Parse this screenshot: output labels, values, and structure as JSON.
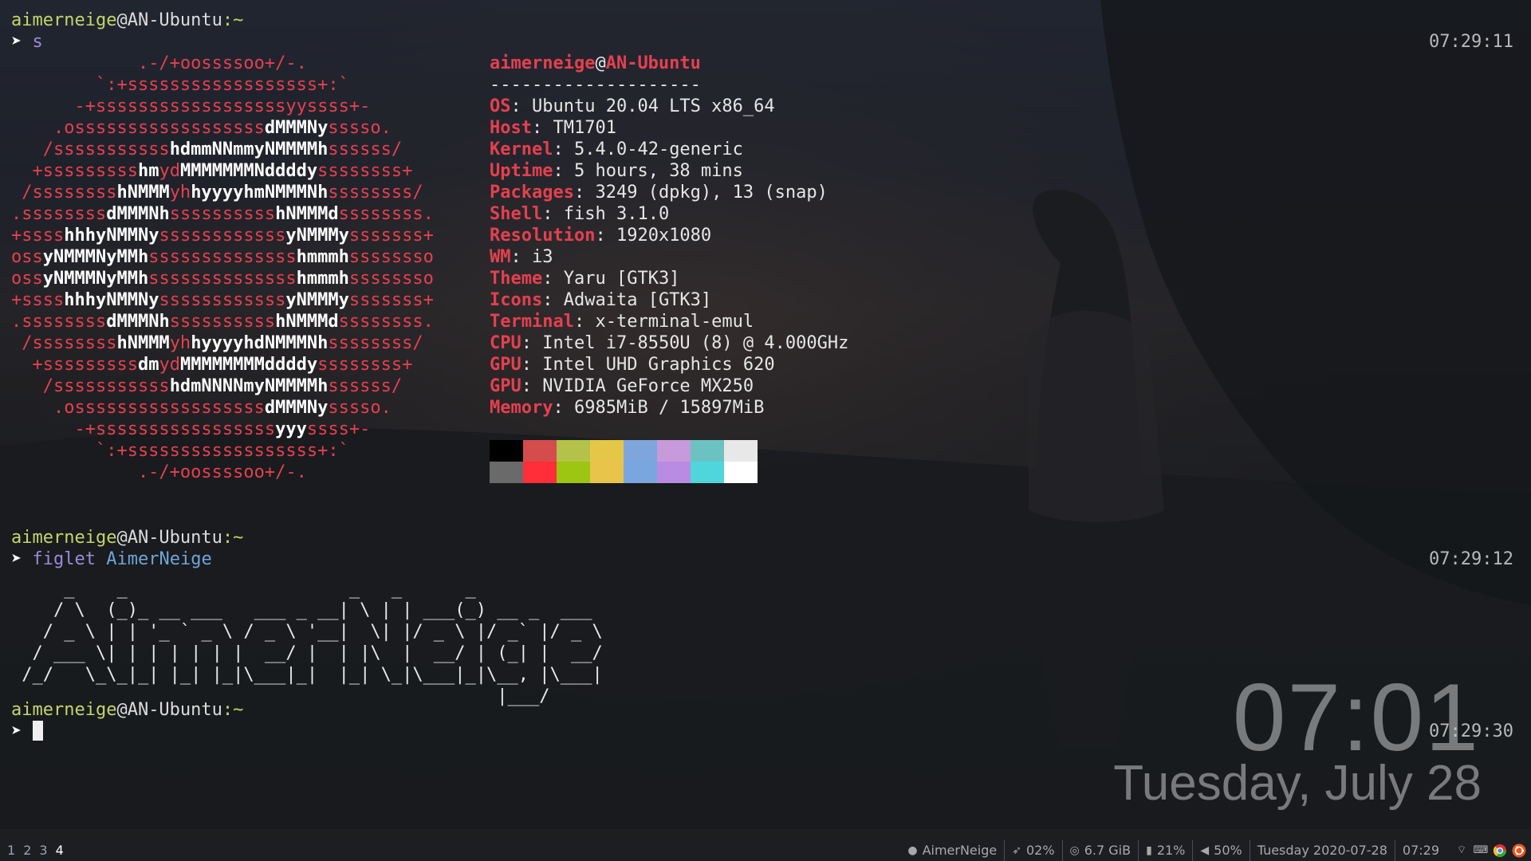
{
  "terminal": {
    "prompt_user": "aimerneige",
    "prompt_host": "@AN-Ubuntu",
    "prompt_path": ":~",
    "prompt_arrow": "➤",
    "cmd1": "s",
    "cmd2_name": "figlet",
    "cmd2_arg": "AimerNeige",
    "time1": "07:29:11",
    "time2": "07:29:12",
    "time3": "07:29:30"
  },
  "neofetch": {
    "logo_lines": [
      [
        [
          "            .-/+oossssoo+/-.",
          0
        ]
      ],
      [
        [
          "        `:+ssssssssssssssssss+:`",
          0
        ]
      ],
      [
        [
          "      -+ssssssssssssssssssyyssss+-",
          0
        ]
      ],
      [
        [
          "    .ossssssssssssssssss",
          0
        ],
        [
          "dMMMNy",
          1
        ],
        [
          "sssso.",
          0
        ]
      ],
      [
        [
          "   /sssssssssss",
          0
        ],
        [
          "hdmmNNmmyNMMMMh",
          1
        ],
        [
          "ssssss/",
          0
        ]
      ],
      [
        [
          "  +sssssssss",
          0
        ],
        [
          "hm",
          1
        ],
        [
          "yd",
          0
        ],
        [
          "MMMMMMMNddddy",
          1
        ],
        [
          "ssssssss+",
          0
        ]
      ],
      [
        [
          " /ssssssss",
          0
        ],
        [
          "hNMMM",
          1
        ],
        [
          "yh",
          0
        ],
        [
          "hyyyyhmNMMMNh",
          1
        ],
        [
          "ssssssss/",
          0
        ]
      ],
      [
        [
          ".ssssssss",
          0
        ],
        [
          "dMMMNh",
          1
        ],
        [
          "ssssssssss",
          0
        ],
        [
          "hNMMMd",
          1
        ],
        [
          "ssssssss.",
          0
        ]
      ],
      [
        [
          "+ssss",
          0
        ],
        [
          "hhhyNMMNy",
          1
        ],
        [
          "ssssssssssss",
          0
        ],
        [
          "yNMMMy",
          1
        ],
        [
          "sssssss+",
          0
        ]
      ],
      [
        [
          "oss",
          0
        ],
        [
          "yNMMMNyMMh",
          1
        ],
        [
          "ssssssssssssss",
          0
        ],
        [
          "hmmmh",
          1
        ],
        [
          "ssssssso",
          0
        ]
      ],
      [
        [
          "oss",
          0
        ],
        [
          "yNMMMNyMMh",
          1
        ],
        [
          "ssssssssssssss",
          0
        ],
        [
          "hmmmh",
          1
        ],
        [
          "ssssssso",
          0
        ]
      ],
      [
        [
          "+ssss",
          0
        ],
        [
          "hhhyNMMNy",
          1
        ],
        [
          "ssssssssssss",
          0
        ],
        [
          "yNMMMy",
          1
        ],
        [
          "sssssss+",
          0
        ]
      ],
      [
        [
          ".ssssssss",
          0
        ],
        [
          "dMMMNh",
          1
        ],
        [
          "ssssssssss",
          0
        ],
        [
          "hNMMMd",
          1
        ],
        [
          "ssssssss.",
          0
        ]
      ],
      [
        [
          " /ssssssss",
          0
        ],
        [
          "hNMMM",
          1
        ],
        [
          "yh",
          0
        ],
        [
          "hyyyyhdNMMMNh",
          1
        ],
        [
          "ssssssss/",
          0
        ]
      ],
      [
        [
          "  +sssssssss",
          0
        ],
        [
          "dm",
          1
        ],
        [
          "yd",
          0
        ],
        [
          "MMMMMMMMddddy",
          1
        ],
        [
          "ssssssss+",
          0
        ]
      ],
      [
        [
          "   /sssssssssss",
          0
        ],
        [
          "hdmNNNNmyNMMMMh",
          1
        ],
        [
          "ssssss/",
          0
        ]
      ],
      [
        [
          "    .ossssssssssssssssss",
          0
        ],
        [
          "dMMMNy",
          1
        ],
        [
          "sssso.",
          0
        ]
      ],
      [
        [
          "      -+sssssssssssssssss",
          0
        ],
        [
          "yyy",
          1
        ],
        [
          "ssss+-",
          0
        ]
      ],
      [
        [
          "        `:+ssssssssssssssssss+:`",
          0
        ]
      ],
      [
        [
          "            .-/+oossssoo+/-.",
          0
        ]
      ]
    ],
    "header_user": "aimerneige",
    "header_at": "@",
    "header_host": "AN-Ubuntu",
    "separator": "--------------------",
    "rows": [
      {
        "key": "OS",
        "value": "Ubuntu 20.04 LTS x86_64"
      },
      {
        "key": "Host",
        "value": "TM1701"
      },
      {
        "key": "Kernel",
        "value": "5.4.0-42-generic"
      },
      {
        "key": "Uptime",
        "value": "5 hours, 38 mins"
      },
      {
        "key": "Packages",
        "value": "3249 (dpkg), 13 (snap)"
      },
      {
        "key": "Shell",
        "value": "fish 3.1.0"
      },
      {
        "key": "Resolution",
        "value": "1920x1080"
      },
      {
        "key": "WM",
        "value": "i3"
      },
      {
        "key": "Theme",
        "value": "Yaru [GTK3]"
      },
      {
        "key": "Icons",
        "value": "Adwaita [GTK3]"
      },
      {
        "key": "Terminal",
        "value": "x-terminal-emul"
      },
      {
        "key": "CPU",
        "value": "Intel i7-8550U (8) @ 4.000GHz"
      },
      {
        "key": "GPU",
        "value": "Intel UHD Graphics 620"
      },
      {
        "key": "GPU",
        "value": "NVIDIA GeForce MX250"
      },
      {
        "key": "Memory",
        "value": "6985MiB / 15897MiB"
      }
    ],
    "palette": [
      "#000000",
      "#d44c4c",
      "#b4c24a",
      "#e5c647",
      "#7fa6dc",
      "#c69adb",
      "#6cc2c0",
      "#e8e8e8",
      "#6a6a6a",
      "#ff2e39",
      "#9cc612",
      "#e8c44a",
      "#7aa6e0",
      "#b98be2",
      "#4fd6dc",
      "#ffffff"
    ]
  },
  "figlet_lines": [
    "     _    _                     _   _      _",
    "    / \\  (_)_ __ ___   ___ _ __| \\ | | ___(_) __ _  ___",
    "   / _ \\ | | '_ ` _ \\ / _ \\ '__|  \\| |/ _ \\ |/ _` |/ _ \\",
    "  / ___ \\| | | | | | |  __/ |  | |\\  |  __/ | (_| |  __/",
    " /_/   \\_\\_|_| |_| |_|\\___|_|  |_| \\_|\\___|_|\\__, |\\___|",
    "                                              |___/"
  ],
  "clock": {
    "time": "07:01",
    "date": "Tuesday, July 28"
  },
  "bar": {
    "workspaces": [
      "1",
      "2",
      "3",
      "4"
    ],
    "active_workspace_index": 3,
    "github": "AimerNeige",
    "cpu": "02%",
    "disk": "6.7 GiB",
    "battery": "21%",
    "volume": "50%",
    "date": "Tuesday 2020-07-28",
    "time": "07:29"
  },
  "icons": {
    "github": "github-icon",
    "cpu": "rocket-icon",
    "disk": "disk-icon",
    "battery": "battery-icon",
    "volume": "speaker-icon",
    "wifi": "wifi-icon",
    "keyboard": "keyboard-icon",
    "chrome": "chrome-icon",
    "ubuntu": "ubuntu-icon"
  },
  "colors": {
    "accent_red": "#e5404f",
    "prompt_green": "#c5d56b",
    "command_purple": "#9c8bd8",
    "arg_blue": "#6fa5d8"
  }
}
